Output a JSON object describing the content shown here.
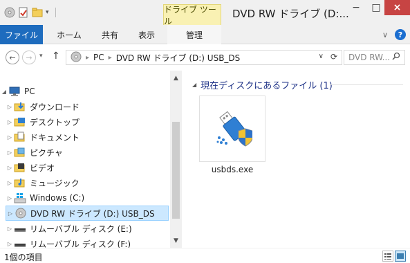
{
  "window": {
    "title": "DVD RW ドライブ (D:...",
    "tools_tab": "ドライブ ツール",
    "minimize": "−",
    "maximize": "□",
    "close": "×"
  },
  "ribbon": {
    "tabs": [
      "ファイル",
      "ホーム",
      "共有",
      "表示",
      "管理"
    ],
    "expand": "∨",
    "help": "?"
  },
  "address": {
    "back": "←",
    "forward": "→",
    "recent": "▾",
    "up": "↑",
    "crumbs": [
      "PC",
      "DVD RW ドライブ (D:) USB_DS"
    ],
    "separator": "▸",
    "dropdown": "∨",
    "refresh": "⟳",
    "search_placeholder": "DVD RW...",
    "search_icon": "search-icon"
  },
  "nav": {
    "items": [
      {
        "label": "PC",
        "icon": "pc-icon",
        "arrow": "◢"
      },
      {
        "label": "ダウンロード",
        "icon": "download-folder-icon",
        "arrow": "▷"
      },
      {
        "label": "デスクトップ",
        "icon": "desktop-folder-icon",
        "arrow": "▷"
      },
      {
        "label": "ドキュメント",
        "icon": "documents-folder-icon",
        "arrow": "▷"
      },
      {
        "label": "ピクチャ",
        "icon": "pictures-folder-icon",
        "arrow": "▷"
      },
      {
        "label": "ビデオ",
        "icon": "videos-folder-icon",
        "arrow": "▷"
      },
      {
        "label": "ミュージック",
        "icon": "music-folder-icon",
        "arrow": "▷"
      },
      {
        "label": "Windows (C:)",
        "icon": "windows-drive-icon",
        "arrow": "▷"
      },
      {
        "label": "DVD RW ドライブ (D:) USB_DS",
        "icon": "dvd-drive-icon",
        "arrow": "▷"
      },
      {
        "label": "リムーバブル ディスク (E:)",
        "icon": "removable-disk-icon",
        "arrow": "▷"
      },
      {
        "label": "リムーバブル ディスク (F:)",
        "icon": "removable-disk-icon",
        "arrow": "▷"
      }
    ],
    "selected_index": 8
  },
  "content": {
    "group_header": "現在ディスクにあるファイル (1)",
    "group_toggle": "◢",
    "files": [
      {
        "name": "usbds.exe",
        "icon": "usb-shield-app-icon"
      }
    ]
  },
  "status": {
    "item_count": "1個の項目"
  },
  "colors": {
    "file_tab": "#1e6cbe",
    "close_button": "#c74443",
    "tools_tab": "#f9f1b3",
    "selection": "#cce8ff",
    "group_header": "#1e3287"
  }
}
